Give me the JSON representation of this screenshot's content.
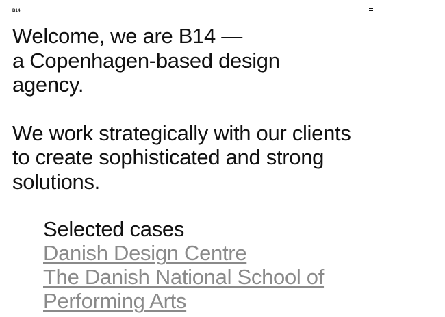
{
  "header": {
    "logo_text": "B14",
    "menu_icon": "hamburger-menu-icon"
  },
  "intro": {
    "paragraph1": [
      "Welcome, we are B14 —",
      "a Copenhagen-based design",
      "agency."
    ],
    "paragraph2": [
      "We work strategically with our clients",
      "to create sophisticated and strong",
      "solutions."
    ]
  },
  "cases": {
    "heading": "Selected cases",
    "items": [
      {
        "label_lines": [
          "Danish Design Centre"
        ]
      },
      {
        "label_lines": [
          "The Danish National School of",
          "Performing Arts"
        ]
      }
    ]
  },
  "colors": {
    "text": "#111111",
    "link": "#8a8a8a",
    "background": "#ffffff"
  }
}
